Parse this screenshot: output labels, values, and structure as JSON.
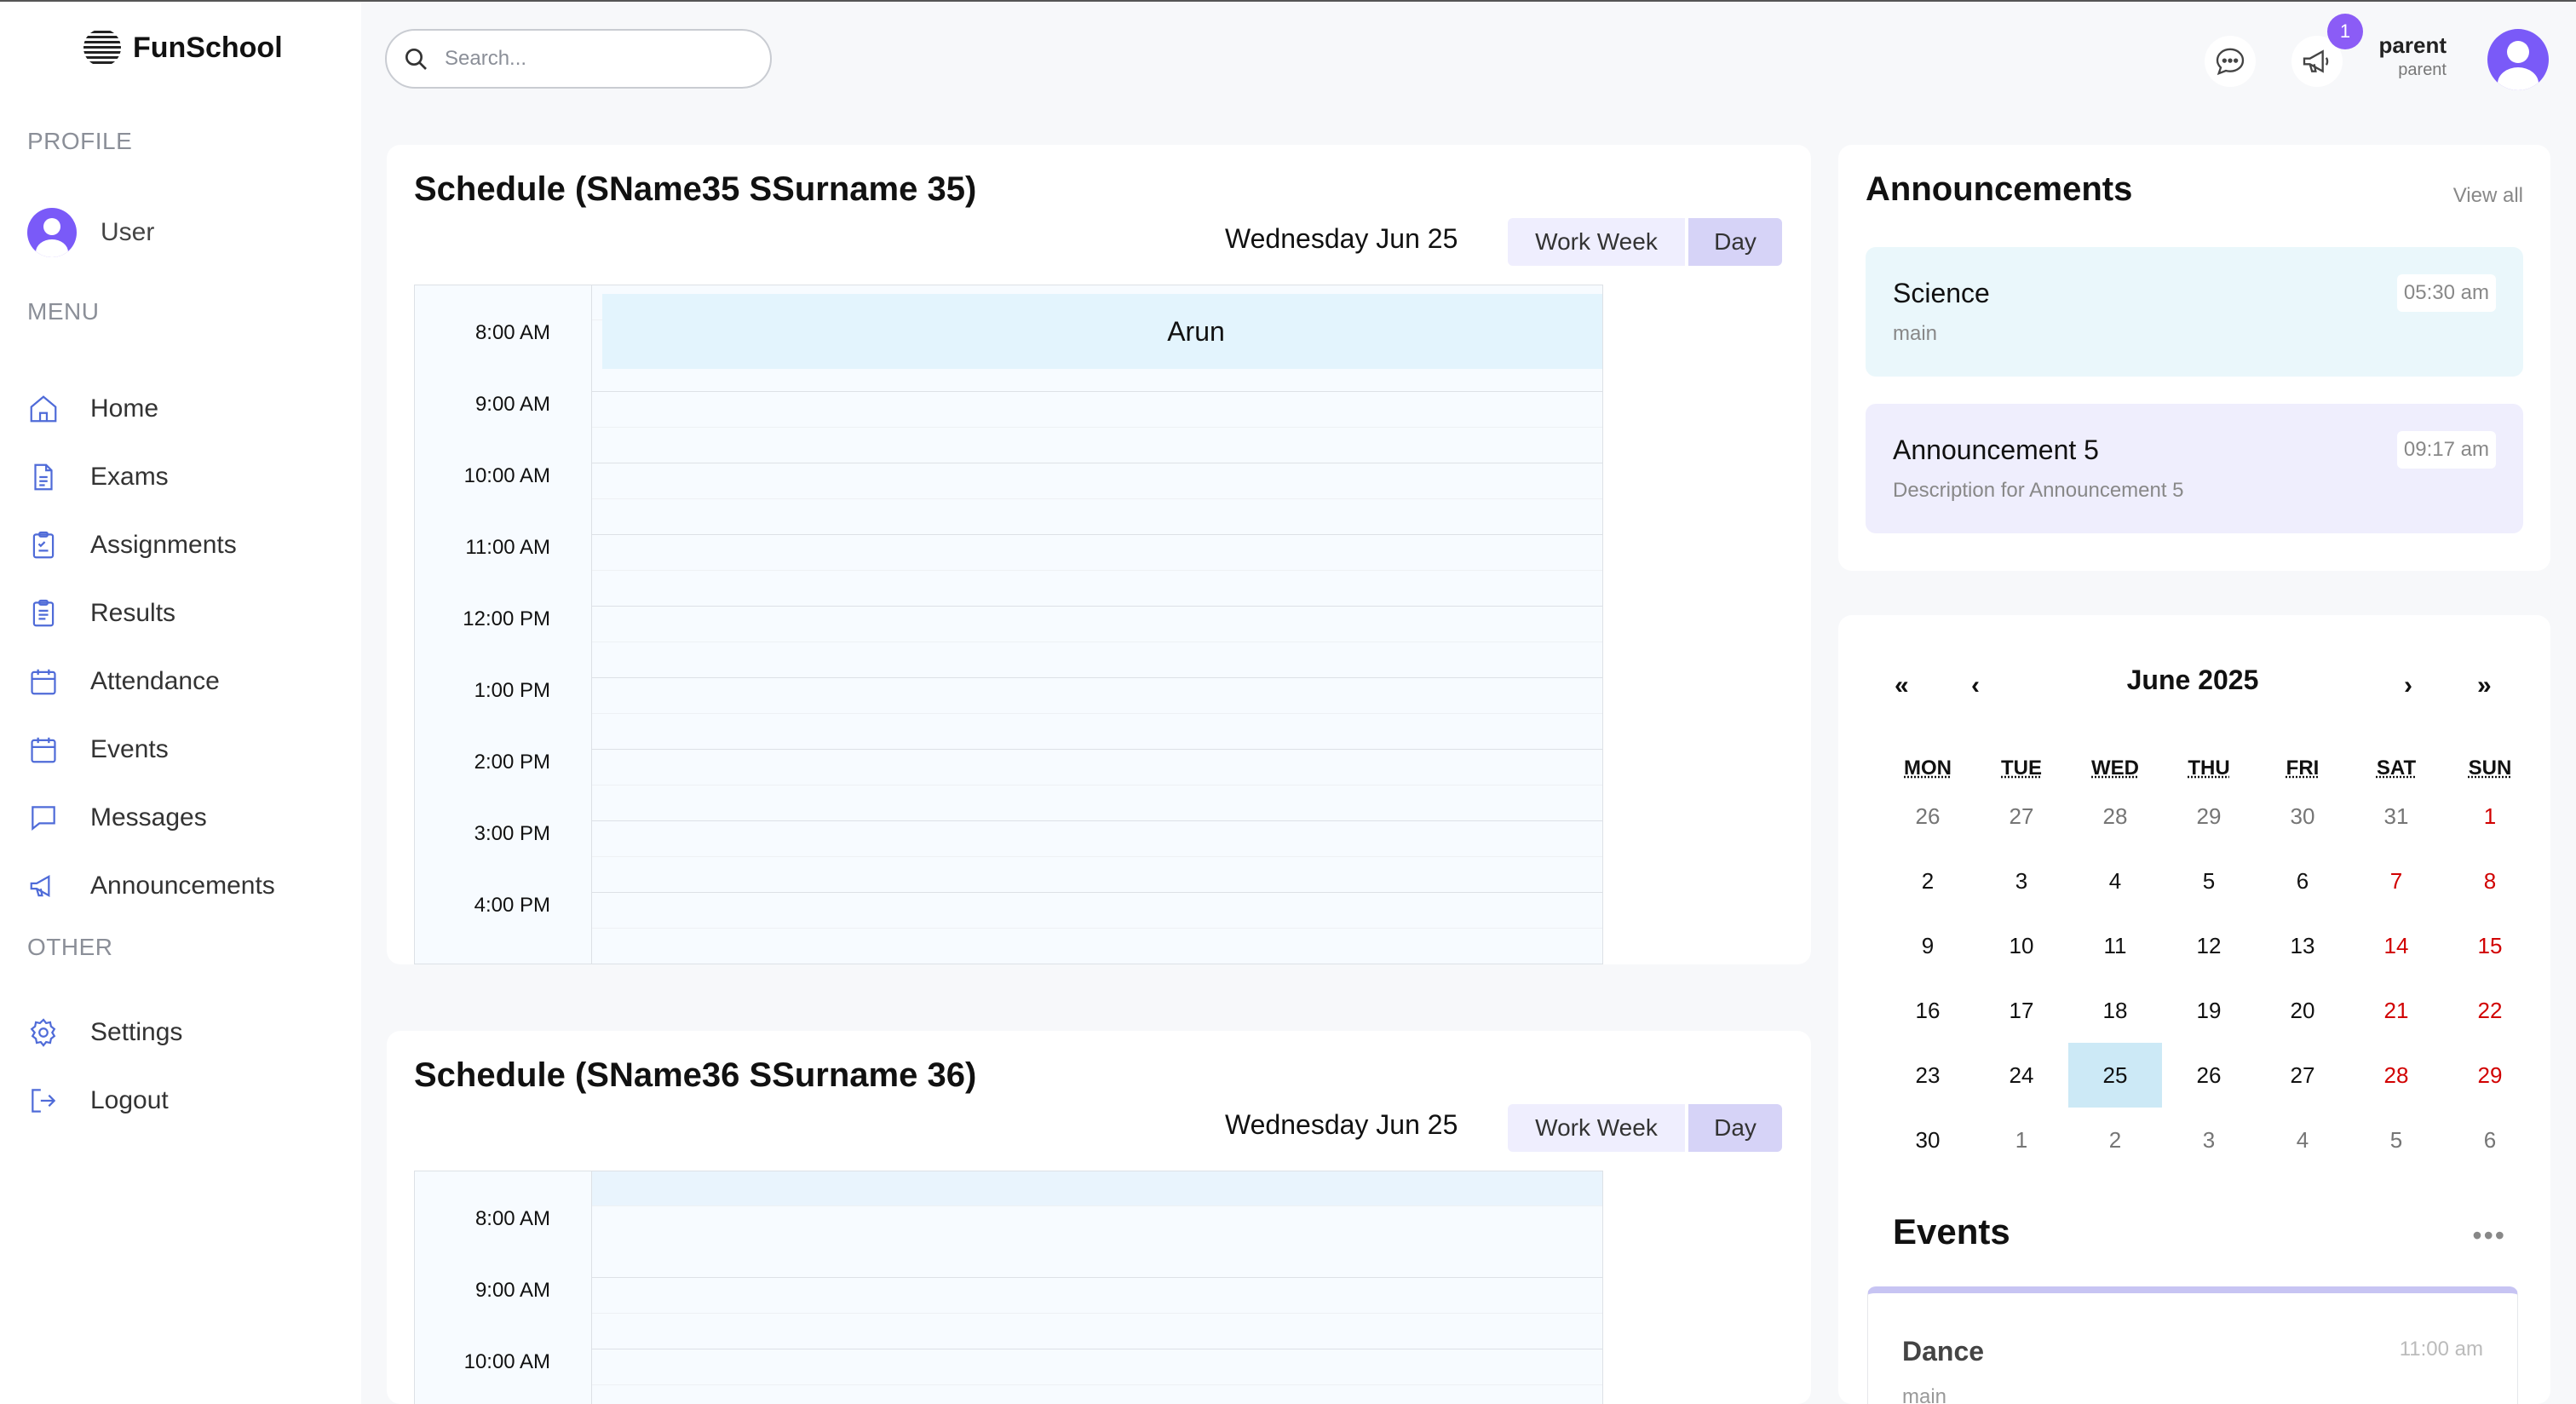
{
  "app": {
    "name": "FunSchool"
  },
  "sidebar": {
    "profile_label": "PROFILE",
    "user_label": "User",
    "menu_label": "MENU",
    "menu": [
      {
        "label": "Home",
        "icon": "home-icon"
      },
      {
        "label": "Exams",
        "icon": "document-icon"
      },
      {
        "label": "Assignments",
        "icon": "clipboard-icon"
      },
      {
        "label": "Results",
        "icon": "clipboard-list-icon"
      },
      {
        "label": "Attendance",
        "icon": "calendar-icon"
      },
      {
        "label": "Events",
        "icon": "calendar-icon"
      },
      {
        "label": "Messages",
        "icon": "message-icon"
      },
      {
        "label": "Announcements",
        "icon": "megaphone-icon"
      }
    ],
    "other_label": "OTHER",
    "other": [
      {
        "label": "Settings",
        "icon": "gear-icon"
      },
      {
        "label": "Logout",
        "icon": "logout-icon"
      }
    ]
  },
  "header": {
    "search_placeholder": "Search...",
    "notification_count": "1",
    "user_name": "parent",
    "user_role": "parent"
  },
  "schedules": [
    {
      "title": "Schedule (SName35 SSurname 35)",
      "date": "Wednesday Jun 25",
      "view_week": "Work Week",
      "view_day": "Day",
      "times": [
        "8:00 AM",
        "9:00 AM",
        "10:00 AM",
        "11:00 AM",
        "12:00 PM",
        "1:00 PM",
        "2:00 PM",
        "3:00 PM",
        "4:00 PM"
      ],
      "event": "Arun"
    },
    {
      "title": "Schedule (SName36 SSurname 36)",
      "date": "Wednesday Jun 25",
      "view_week": "Work Week",
      "view_day": "Day",
      "times": [
        "8:00 AM",
        "9:00 AM",
        "10:00 AM"
      ]
    }
  ],
  "announcements": {
    "title": "Announcements",
    "view_all": "View all",
    "items": [
      {
        "name": "Science",
        "desc": "main",
        "time": "05:30 am",
        "color": "#eaf7fb"
      },
      {
        "name": "Announcement 5",
        "desc": "Description for Announcement 5",
        "time": "09:17 am",
        "color": "#efeefd"
      }
    ]
  },
  "calendar": {
    "month": "June 2025",
    "prev_year": "«",
    "prev": "‹",
    "next": "›",
    "next_year": "»",
    "weekdays": [
      "MON",
      "TUE",
      "WED",
      "THU",
      "FRI",
      "SAT",
      "SUN"
    ],
    "days": [
      [
        "26",
        "27",
        "28",
        "29",
        "30",
        "31",
        "1"
      ],
      [
        "2",
        "3",
        "4",
        "5",
        "6",
        "7",
        "8"
      ],
      [
        "9",
        "10",
        "11",
        "12",
        "13",
        "14",
        "15"
      ],
      [
        "16",
        "17",
        "18",
        "19",
        "20",
        "21",
        "22"
      ],
      [
        "23",
        "24",
        "25",
        "26",
        "27",
        "28",
        "29"
      ],
      [
        "30",
        "1",
        "2",
        "3",
        "4",
        "5",
        "6"
      ]
    ],
    "selected": "25",
    "colors": {
      "weekend": "#d10000",
      "outside": "#757575",
      "selected_bg": "#cce9f6"
    }
  },
  "events": {
    "title": "Events",
    "more": "•••",
    "items": [
      {
        "name": "Dance",
        "time": "11:00 am",
        "desc": "main"
      }
    ]
  }
}
